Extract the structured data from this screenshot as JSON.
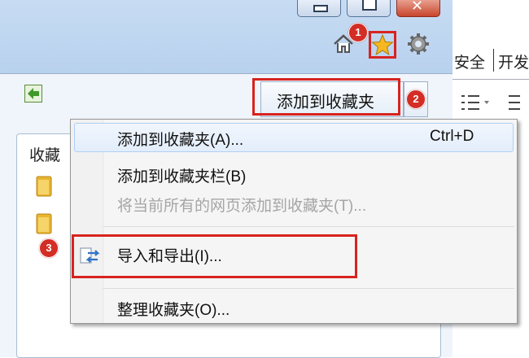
{
  "badges": {
    "one": "1",
    "two": "2",
    "three": "3"
  },
  "right_tabs": {
    "security": "安全",
    "developer": "开发"
  },
  "favorites_panel": {
    "add_button_label": "添加到收藏夹",
    "list_title": "收藏",
    "folders": [
      "",
      ""
    ]
  },
  "context_menu": {
    "items": [
      {
        "label": "添加到收藏夹(A)...",
        "shortcut": "Ctrl+D",
        "state": "hover"
      },
      {
        "label": "添加到收藏夹栏(B)",
        "state": "enabled"
      },
      {
        "label": "将当前所有的网页添加到收藏夹(T)...",
        "state": "disabled"
      },
      {
        "label": "导入和导出(I)...",
        "state": "highlighted"
      },
      {
        "label": "整理收藏夹(O)...",
        "state": "enabled"
      }
    ]
  },
  "colors": {
    "highlight_red": "#d8231f",
    "chrome_blue": "#b8d1ee",
    "star_gold": "#f5b820"
  }
}
